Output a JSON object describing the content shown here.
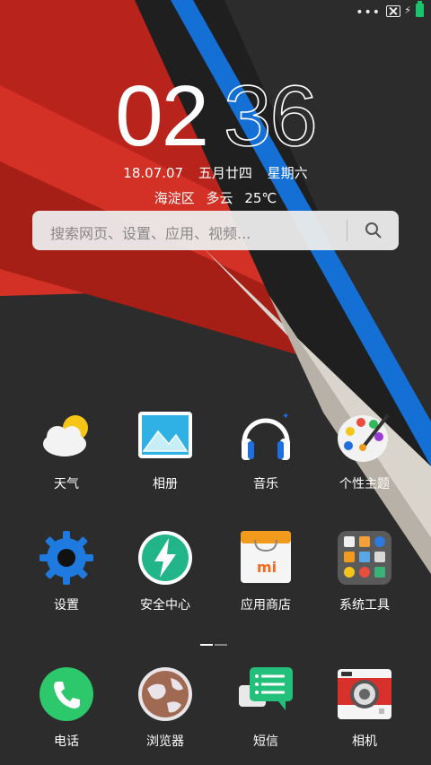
{
  "status_bar": {
    "dots": "•••",
    "icons": [
      "more-dots-icon",
      "no-sim-icon",
      "charging-icon",
      "battery-icon"
    ],
    "battery_color": "#16c66b"
  },
  "clock": {
    "hours": "02",
    "minutes": "36",
    "date": "18.07.07",
    "lunar_date": "五月廿四",
    "weekday": "星期六",
    "location": "海淀区",
    "weather": "多云",
    "temperature": "25℃"
  },
  "search": {
    "placeholder": "搜索网页、设置、应用、视频..."
  },
  "apps": [
    {
      "label": "天气",
      "icon": "weather-icon"
    },
    {
      "label": "相册",
      "icon": "gallery-icon"
    },
    {
      "label": "音乐",
      "icon": "music-icon"
    },
    {
      "label": "个性主题",
      "icon": "themes-icon"
    },
    {
      "label": "设置",
      "icon": "settings-icon"
    },
    {
      "label": "安全中心",
      "icon": "security-icon"
    },
    {
      "label": "应用商店",
      "icon": "app-store-icon"
    },
    {
      "label": "系统工具",
      "icon": "system-tools-folder-icon"
    }
  ],
  "dock": [
    {
      "label": "电话",
      "icon": "phone-icon"
    },
    {
      "label": "浏览器",
      "icon": "browser-icon"
    },
    {
      "label": "短信",
      "icon": "messages-icon"
    },
    {
      "label": "相机",
      "icon": "camera-icon"
    }
  ],
  "colors": {
    "wallpaper_red": "#c8281f",
    "wallpaper_blue": "#1570d6",
    "wallpaper_dark": "#2b2b2b"
  }
}
